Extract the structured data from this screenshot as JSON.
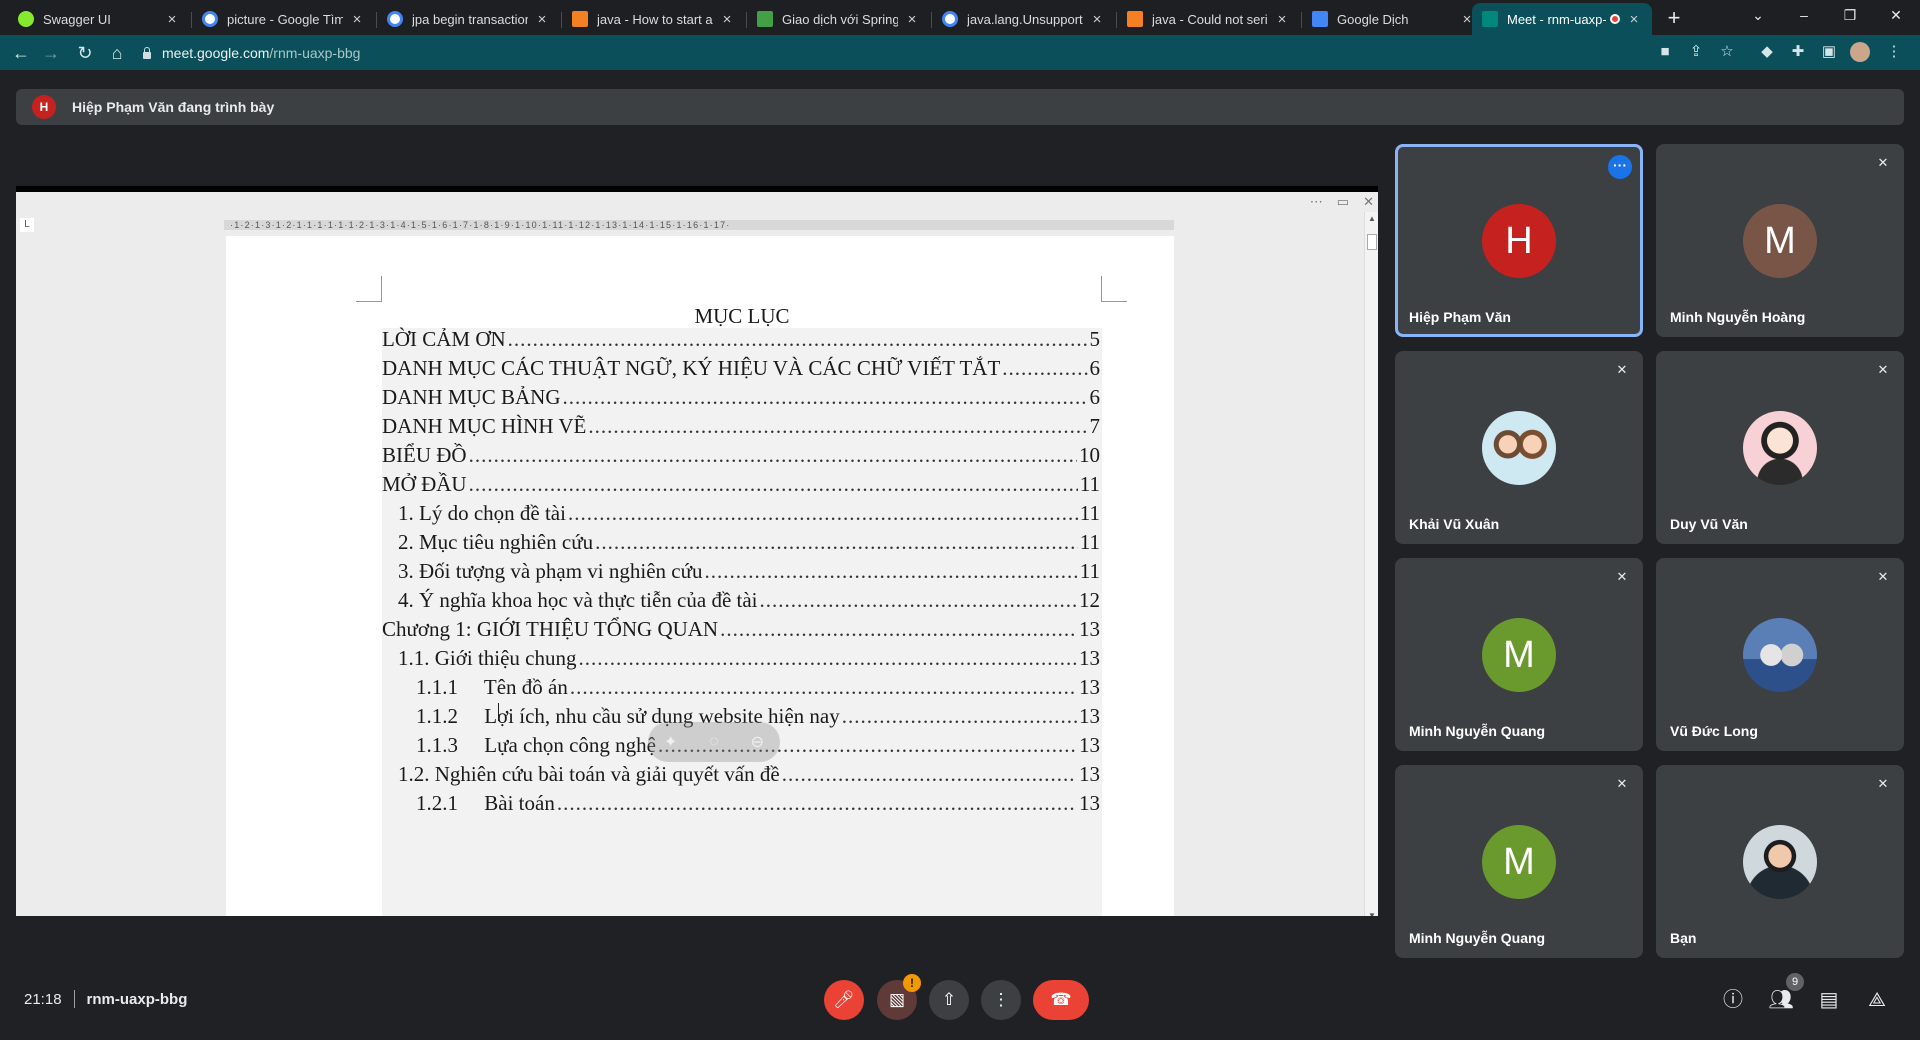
{
  "browser": {
    "tabs": [
      {
        "label": "Swagger UI",
        "favicon_color": "#85ea2d"
      },
      {
        "label": "picture - Google Tìm kiếm",
        "favicon_color": "#ffffff"
      },
      {
        "label": "jpa begin transaction",
        "favicon_color": "#ffffff"
      },
      {
        "label": "java - How to start a tr",
        "favicon_color": "#f48024"
      },
      {
        "label": "Giao dịch với Spring và",
        "favicon_color": "#43a047"
      },
      {
        "label": "java.lang.Unsupported",
        "favicon_color": "#ffffff"
      },
      {
        "label": "java - Could not serial",
        "favicon_color": "#f48024"
      },
      {
        "label": "Google Dịch",
        "favicon_color": "#4285f4"
      },
      {
        "label": "Meet - rnm-uaxp-",
        "favicon_color": "#00897b"
      }
    ],
    "address": {
      "host": "meet.google.com",
      "path": "/rnm-uaxp-bbg"
    }
  },
  "meet": {
    "presenter": {
      "initial": "H",
      "text": "Hiệp Phạm Văn đang trình bày"
    },
    "meeting_time": "21:18",
    "meeting_code": "rnm-uaxp-bbg",
    "participant_count": "9",
    "participants": [
      {
        "name": "Hiệp Phạm Văn",
        "initial": "H",
        "color": "#c5221f"
      },
      {
        "name": "Minh Nguyễn Hoàng",
        "initial": "M",
        "color": "#795548"
      },
      {
        "name": "Khải Vũ Xuân",
        "initial": "",
        "color": ""
      },
      {
        "name": "Duy Vũ Văn",
        "initial": "",
        "color": ""
      },
      {
        "name": "Minh Nguyễn Quang",
        "initial": "M",
        "color": "#6a9a2e"
      },
      {
        "name": "Vũ Đức Long",
        "initial": "",
        "color": ""
      },
      {
        "name": "Minh Nguyễn Quang",
        "initial": "M",
        "color": "#6a9a2e"
      },
      {
        "name": "Bạn",
        "initial": "",
        "color": ""
      }
    ]
  },
  "document": {
    "ruler_text": "·1·2·1·3·1·2·1·1·1·1·1·1·2·1·3·1·4·1·5·1·6·1·7·1·8·1·9·1·10·1·11·1·12·1·13·1·14·1·15·1·16·1·17·",
    "title": "MỤC LỤC",
    "toc": [
      {
        "text": "LỜI CẢM ƠN",
        "page": "5"
      },
      {
        "text": "DANH MỤC CÁC THUẬT NGỮ, KÝ HIỆU VÀ CÁC CHỮ VIẾT TẮT",
        "page": "6"
      },
      {
        "text": "DANH MỤC BẢNG",
        "page": "6"
      },
      {
        "text": "DANH MỤC HÌNH VẼ",
        "page": "7"
      },
      {
        "text": "BIỂU ĐỒ",
        "page": "10"
      },
      {
        "text": "MỞ ĐẦU",
        "page": "11"
      },
      {
        "text": "1. Lý do chọn đề tài",
        "page": "11"
      },
      {
        "text": "2. Mục tiêu nghiên cứu",
        "page": "11"
      },
      {
        "text": "3. Đối tượng và phạm vi nghiên cứu",
        "page": "11"
      },
      {
        "text": "4. Ý nghĩa khoa học và thực tiễn của đề tài",
        "page": "12"
      },
      {
        "text": "Chương 1: GIỚI THIỆU TỔNG QUAN",
        "page": "13"
      },
      {
        "text": "1.1. Giới thiệu chung",
        "page": "13"
      },
      {
        "text": "1.1.1     Tên đồ án",
        "page": "13"
      },
      {
        "text": "1.1.2     Lợi ích, nhu cầu sử dụng website hiện nay",
        "page": "13"
      },
      {
        "text": "1.1.3     Lựa chọn công nghệ",
        "page": "13"
      },
      {
        "text": "1.2. Nghiên cứu bài toán và giải quyết vấn đề",
        "page": "13"
      },
      {
        "text": "1.2.1     Bài toán",
        "page": "13"
      }
    ]
  }
}
